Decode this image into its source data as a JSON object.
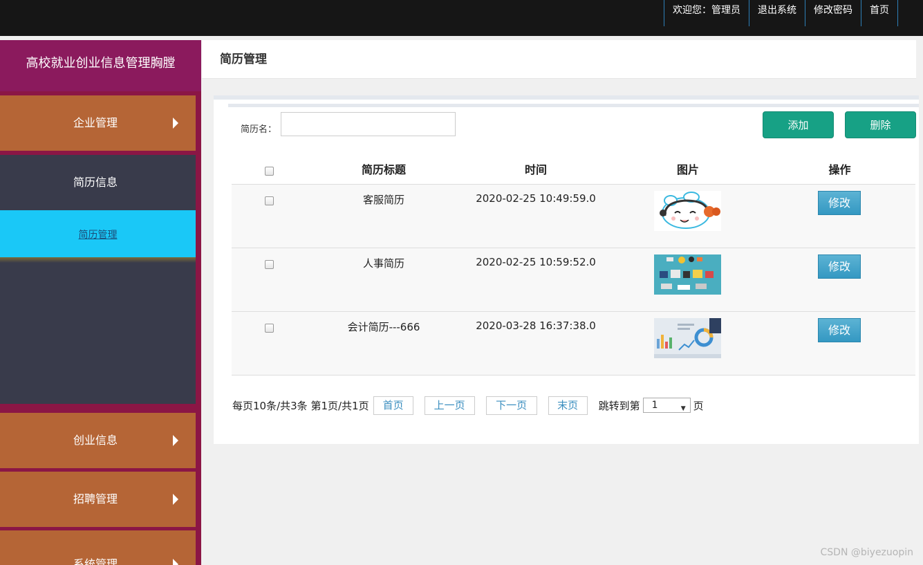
{
  "topbar": {
    "welcome": "欢迎您：管理员",
    "logout": "退出系统",
    "change_password": "修改密码",
    "home": "首页"
  },
  "sidebar": {
    "brand": "高校就业创业信息管理胸膛",
    "menu_enterprise": "企业管理",
    "menu_resume": "简历信息",
    "submenu_resume_manage": "简历管理",
    "menu_startup": "创业信息",
    "menu_recruit": "招聘管理",
    "menu_system": "系统管理"
  },
  "page": {
    "title": "简历管理"
  },
  "search": {
    "label": "简历名：",
    "value": "",
    "placeholder": ""
  },
  "actions": {
    "add": "添加",
    "delete": "删除"
  },
  "table": {
    "headers": [
      "简历标题",
      "时间",
      "图片",
      "操作"
    ],
    "rows": [
      {
        "title": "客服简历",
        "time": "2020-02-25 10:49:59.0",
        "image_icon": "customer-service-cartoon-image",
        "action": "修改"
      },
      {
        "title": "人事简历",
        "time": "2020-02-25 10:59:52.0",
        "image_icon": "office-supplies-photo-image",
        "action": "修改"
      },
      {
        "title": "会计简历---666",
        "time": "2020-03-28 16:37:38.0",
        "image_icon": "financial-charts-photo-image",
        "action": "修改"
      }
    ]
  },
  "pagination": {
    "summary": "每页10条/共3条 第1页/共1页",
    "first": "首页",
    "prev": "上一页",
    "next": "下一页",
    "last": "末页",
    "jump_label": "跳转到第",
    "jump_value": "1",
    "jump_suffix": "页"
  },
  "watermark": "CSDN @biyezuopin",
  "colors": {
    "topbar": "#161616",
    "sidebar_brand": "#8b1a5d",
    "menu_item": "#b56536",
    "menu_open": "#393b4b",
    "submenu_active": "#1ac8f7",
    "button_green": "#17a185",
    "button_edit": "#3498c2"
  }
}
